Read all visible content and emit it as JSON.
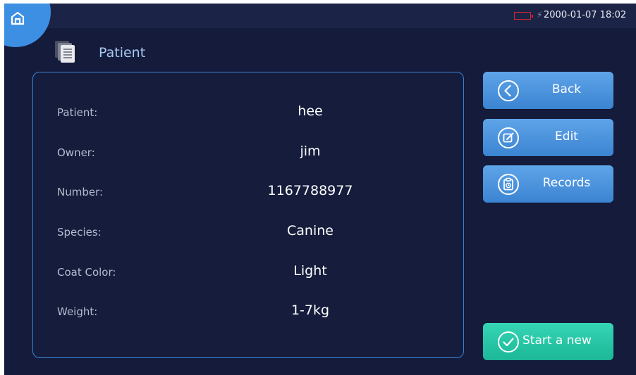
{
  "status_bar": {
    "datetime": "2000-01-07 18:02"
  },
  "icons": {
    "home": "home-icon",
    "title": "document-stack-icon",
    "back": "chevron-left-circle-icon",
    "edit": "edit-circle-icon",
    "records": "clipboard-clock-icon",
    "start": "check-circle-icon",
    "battery": "battery-empty-icon",
    "charging": "lightning-icon"
  },
  "colors": {
    "background": "#141b3b",
    "accent_blue": "#4b95de",
    "accent_green": "#26c6a6",
    "battery_low": "#d2262a"
  },
  "page": {
    "title": "Patient"
  },
  "patient": {
    "fields": [
      {
        "label": "Patient:",
        "value": "hee"
      },
      {
        "label": "Owner:",
        "value": "jim"
      },
      {
        "label": "Number:",
        "value": "1167788977"
      },
      {
        "label": "Species:",
        "value": "Canine"
      },
      {
        "label": "Coat Color:",
        "value": "Light"
      },
      {
        "label": "Weight:",
        "value": "1-7kg"
      }
    ]
  },
  "actions": {
    "back": "Back",
    "edit": "Edit",
    "records": "Records",
    "start_new": "Start a new"
  }
}
